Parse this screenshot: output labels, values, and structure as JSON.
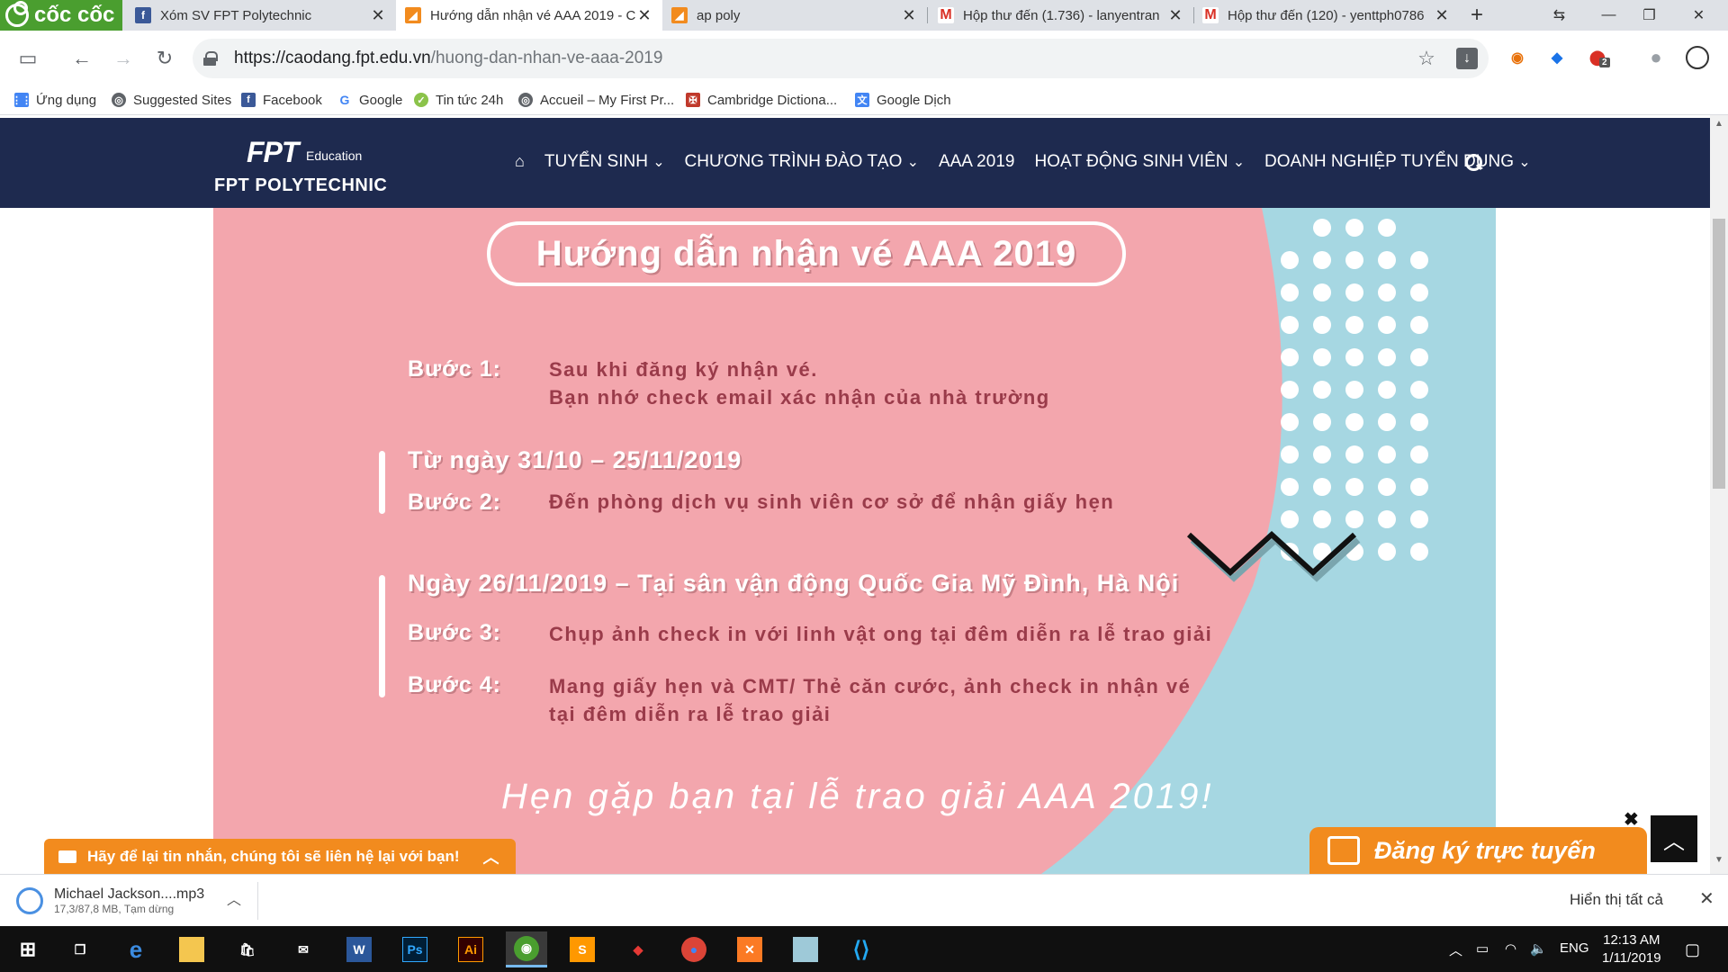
{
  "browser": {
    "brand": "cốc cốc",
    "tabs": [
      {
        "title": "Xóm SV FPT Polytechnic",
        "icon": "facebook-icon",
        "color": "#3b5998"
      },
      {
        "title": "Hướng dẫn nhận vé AAA 2019 - C",
        "icon": "fpt-favicon-icon",
        "color": "#f28b1e"
      },
      {
        "title": "ap poly",
        "icon": "fpt-favicon-icon",
        "color": "#f28b1e"
      },
      {
        "title": "Hộp thư đến (1.736) - lanyentran",
        "icon": "gmail-icon",
        "color": "#d93025"
      },
      {
        "title": "Hộp thư đến (120) - yenttph0786",
        "icon": "gmail-icon",
        "color": "#d93025"
      }
    ],
    "url_host": "https://caodang.fpt.edu.vn",
    "url_path": "/huong-dan-nhan-ve-aaa-2019",
    "extension_badge": "2"
  },
  "bookmarks": [
    {
      "label": "Ứng dụng",
      "icon": "apps-grid-icon"
    },
    {
      "label": "Suggested Sites",
      "icon": "globe-icon"
    },
    {
      "label": "Facebook",
      "icon": "facebook-icon"
    },
    {
      "label": "Google",
      "icon": "google-icon"
    },
    {
      "label": "Tin tức 24h",
      "icon": "news-icon"
    },
    {
      "label": "Accueil – My First Pr...",
      "icon": "globe-icon"
    },
    {
      "label": "Cambridge Dictiona...",
      "icon": "cambridge-icon"
    },
    {
      "label": "Google Dịch",
      "icon": "google-translate-icon"
    }
  ],
  "site": {
    "logo_fpt": "FPT",
    "logo_edu": "Education",
    "logo_poly": "FPT POLYTECHNIC",
    "nav": [
      {
        "label": "TUYỂN SINH",
        "dropdown": true
      },
      {
        "label": "CHƯƠNG TRÌNH ĐÀO TẠO",
        "dropdown": true
      },
      {
        "label": "AAA 2019",
        "dropdown": false
      },
      {
        "label": "HOẠT ĐỘNG SINH VIÊN",
        "dropdown": true
      },
      {
        "label": "DOANH NGHIỆP TUYỂN DỤNG",
        "dropdown": true
      }
    ]
  },
  "banner": {
    "title": "Hướng dẫn nhận vé AAA 2019",
    "step1_label": "Bước 1:",
    "step1_text_line1": "Sau khi đăng ký nhận vé.",
    "step1_text_line2": "Bạn nhớ check email xác nhận của nhà trường",
    "period1": "Từ ngày 31/10 – 25/11/2019",
    "step2_label": "Bước 2:",
    "step2_text": "Đến phòng dịch vụ sinh viên cơ sở để nhận giấy hẹn",
    "period2": "Ngày 26/11/2019 – Tại sân vận động Quốc Gia Mỹ Đình, Hà Nội",
    "step3_label": "Bước 3:",
    "step3_text": "Chụp ảnh check in với linh vật ong tại đêm diễn ra lễ trao giải",
    "step4_label": "Bước 4:",
    "step4_text_line1": "Mang giấy hẹn và CMT/ Thẻ căn cước, ảnh check in nhận vé",
    "step4_text_line2": "tại đêm diễn ra lễ trao giải",
    "closing": "Hẹn gặp bạn tại lễ trao giải AAA 2019!",
    "colors": {
      "pink": "#f3a6ad",
      "blue": "#a6d7e2",
      "text_dark": "#9a3b4a"
    }
  },
  "chat_bar": {
    "label": "Hãy để lại tin nhắn, chúng tôi sẽ liên hệ lại với bạn!"
  },
  "register_button": {
    "label": "Đăng ký trực tuyến"
  },
  "download": {
    "filename": "Michael Jackson....mp3",
    "status": "17,3/87,8 MB, Tạm dừng",
    "show_all": "Hiển thị tất cả"
  },
  "taskbar": {
    "apps": [
      "windows-start-icon",
      "task-view-icon",
      "edge-icon",
      "file-explorer-icon",
      "store-icon",
      "mail-icon",
      "word-icon",
      "photoshop-icon",
      "illustrator-icon",
      "coccoc-icon",
      "sublime-icon",
      "game-icon",
      "chrome-icon",
      "xampp-icon",
      "notepad-icon",
      "vscode-icon"
    ],
    "language": "ENG",
    "time": "12:13 AM",
    "date": "1/11/2019"
  }
}
